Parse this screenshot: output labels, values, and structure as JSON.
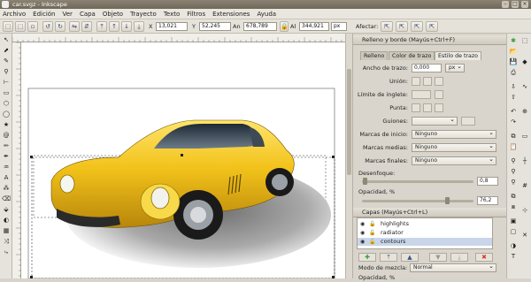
{
  "window": {
    "title": "car.svgz - Inkscape"
  },
  "menu": [
    "Archivo",
    "Edición",
    "Ver",
    "Capa",
    "Objeto",
    "Trayecto",
    "Texto",
    "Filtros",
    "Extensiones",
    "Ayuda"
  ],
  "controls": {
    "x_label": "X",
    "x_value": "13,021",
    "y_label": "Y",
    "y_value": "52,245",
    "w_label": "An",
    "w_value": "678,789",
    "h_label": "Al",
    "h_value": "344,921",
    "unit": "px",
    "affect_label": "Afectar:"
  },
  "fill_stroke": {
    "title": "Relleno y borde (Mayús+Ctrl+F)",
    "tabs": [
      "Relleno",
      "Color de trazo",
      "Estilo de trazo"
    ],
    "active_tab": 2,
    "stroke_width_label": "Ancho de trazo:",
    "stroke_width_value": "0,000",
    "stroke_width_unit": "px",
    "join_label": "Unión:",
    "miter_label": "Límite de inglete:",
    "cap_label": "Punta:",
    "dashes_label": "Guiones:",
    "start_marker_label": "Marcas de inicio:",
    "start_marker_value": "Ninguno",
    "mid_marker_label": "Marcas medias:",
    "mid_marker_value": "Ninguno",
    "end_marker_label": "Marcas finales:",
    "end_marker_value": "Ninguno",
    "blur_label": "Desenfoque:",
    "blur_value": "0,8",
    "blur_fraction": 0.02,
    "opacity_label": "Opacidad, %",
    "opacity_value": "76,2",
    "opacity_fraction": 0.762
  },
  "layers": {
    "title": "Capas (Mayús+Ctrl+L)",
    "items": [
      {
        "name": "highlights",
        "selected": false
      },
      {
        "name": "radiator",
        "selected": false
      },
      {
        "name": "contours",
        "selected": true
      }
    ],
    "blend_label": "Modo de mezcla:",
    "blend_value": "Normal",
    "opacity_label": "Opacidad, %"
  },
  "colors": {
    "car_body": "#f2c21a",
    "car_shadow": "#b8860b",
    "accent_green": "#3a9a3a",
    "accent_red": "#d23a2a"
  }
}
